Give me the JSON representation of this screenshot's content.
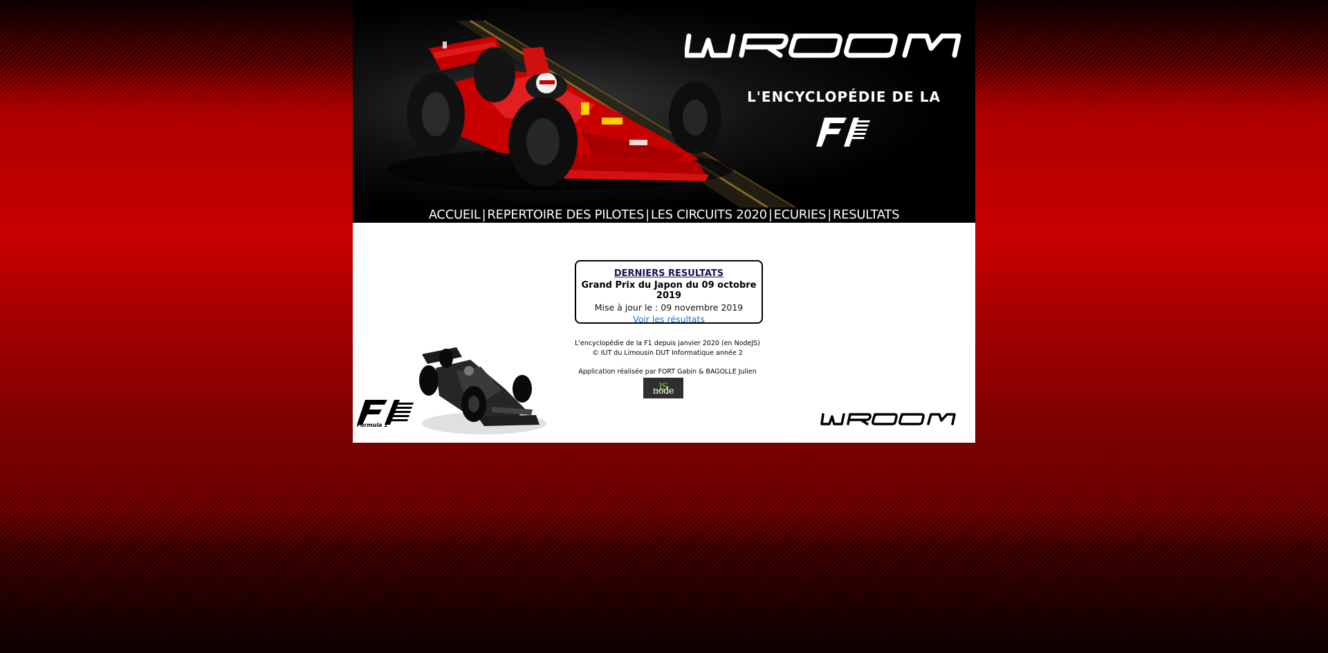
{
  "banner": {
    "logo_text": "WROOM",
    "tagline": "L'ENCYCLOPÉDIE DE LA",
    "f1_logo_text": "F1"
  },
  "nav": {
    "items": [
      {
        "label": "ACCUEIL"
      },
      {
        "label": "REPERTOIRE DES PILOTES"
      },
      {
        "label": "LES CIRCUITS 2020"
      },
      {
        "label": "ECURIES"
      },
      {
        "label": "RESULTATS"
      }
    ],
    "separator": "|"
  },
  "results": {
    "title": "DERNIERS RESULTATS",
    "grand_prix": "Grand Prix du Japon du 09 octobre 2019",
    "updated": "Mise à jour le : 09 novembre 2019",
    "link": "Voir les résultats"
  },
  "footer": {
    "line1": "L'encyclopédie de la F1 depuis janvier 2020 (en NodeJS)",
    "line2": "© IUT du Limousin DUT Informatique année 2",
    "credit": "Application réalisée par FORT Gabin & BAGOLLE Julien",
    "badge_node": "node",
    "badge_js": "JS",
    "f1_label": "Formula 1",
    "logo_text": "WROOM"
  },
  "colors": {
    "brand_red": "#cc0000",
    "link_blue": "#1a6ed8",
    "title_navy": "#141450",
    "nodejs_green": "#8cc84b"
  }
}
